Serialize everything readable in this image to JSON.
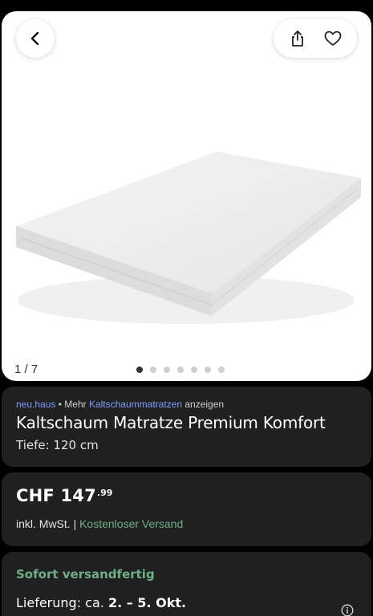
{
  "gallery": {
    "counter": "1 / 7",
    "dots_total": 7,
    "active_dot": 0
  },
  "icons": {
    "back": "chevron-left-icon",
    "share": "share-icon",
    "favorite": "heart-icon",
    "info": "info-icon"
  },
  "product": {
    "brand": "neu.haus",
    "more_prefix": "• Mehr",
    "category_link": "Kaltschaummatratzen",
    "more_suffix": "anzeigen",
    "title": "Kaltschaum Matratze Premium Komfort",
    "variant": "Tiefe: 120 cm"
  },
  "pricing": {
    "currency_amount": "CHF 147",
    "cents": ".99",
    "tax_note": "inkl. MwSt. |",
    "shipping_note": "Kostenloser Versand"
  },
  "availability": {
    "status": "Sofort versandfertig",
    "delivery_prefix": "Lieferung: ca.",
    "delivery_dates": "2. – 5. Okt."
  },
  "colors": {
    "accent_green": "#6fae86",
    "link_blue": "#7e9cff",
    "card_bg": "#202020"
  }
}
